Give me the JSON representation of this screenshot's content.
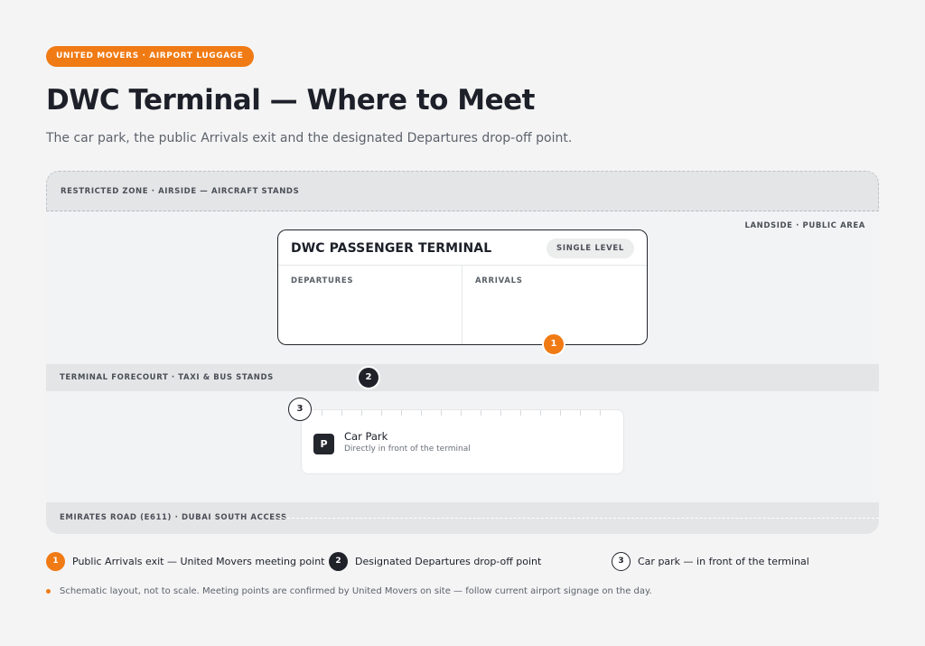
{
  "badge": "UNITED MOVERS · AIRPORT LUGGAGE",
  "title": "DWC Terminal — Where to Meet",
  "subtitle": "The car park, the public Arrivals exit and the designated Departures drop-off point.",
  "map": {
    "restricted_zone": "RESTRICTED ZONE · AIRSIDE — AIRCRAFT STANDS",
    "landside": "LANDSIDE · PUBLIC AREA",
    "terminal": {
      "title": "DWC PASSENGER TERMINAL",
      "tag": "SINGLE LEVEL",
      "departures": "DEPARTURES",
      "arrivals": "ARRIVALS"
    },
    "forecourt": "TERMINAL FORECOURT · TAXI & BUS STANDS",
    "car_park": {
      "icon_letter": "P",
      "title": "Car Park",
      "subtitle": "Directly in front of the terminal"
    },
    "road": "EMIRATES ROAD (E611) · DUBAI SOUTH ACCESS",
    "markers": {
      "m1": "1",
      "m2": "2",
      "m3": "3"
    }
  },
  "legend": [
    {
      "number": "1",
      "text": "Public Arrivals exit — United Movers meeting point",
      "style": "orange"
    },
    {
      "number": "2",
      "text": "Designated Departures drop-off point",
      "style": "dark"
    },
    {
      "number": "3",
      "text": "Car park — in front of the terminal",
      "style": "outline"
    }
  ],
  "note": "Schematic layout, not to scale. Meeting points are confirmed by United Movers on site — follow current airport signage on the day.",
  "colors": {
    "accent": "#f07a14",
    "dark": "#1f2229",
    "band": "#e4e5e7",
    "background": "#f4f4f5"
  }
}
